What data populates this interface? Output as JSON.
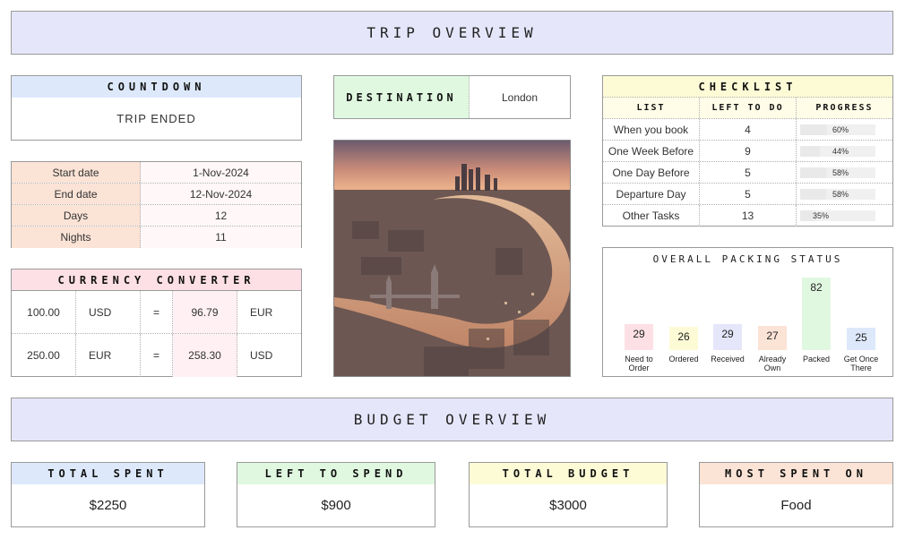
{
  "trip_overview": {
    "title": "TRIP OVERVIEW"
  },
  "countdown": {
    "title": "COUNTDOWN",
    "status": "TRIP ENDED"
  },
  "dates": {
    "rows": [
      {
        "label": "Start date",
        "value": "1-Nov-2024"
      },
      {
        "label": "End date",
        "value": "12-Nov-2024"
      },
      {
        "label": "Days",
        "value": "12"
      },
      {
        "label": "Nights",
        "value": "11"
      }
    ]
  },
  "currency": {
    "title": "CURRENCY CONVERTER",
    "rows": [
      {
        "amount": "100.00",
        "from": "USD",
        "eq": "=",
        "result": "96.79",
        "to": "EUR"
      },
      {
        "amount": "250.00",
        "from": "EUR",
        "eq": "=",
        "result": "258.30",
        "to": "USD"
      }
    ]
  },
  "destination": {
    "label": "DESTINATION",
    "value": "London"
  },
  "checklist": {
    "title": "CHECKLIST",
    "headers": [
      "LIST",
      "LEFT TO DO",
      "PROGRESS"
    ],
    "rows": [
      {
        "list": "When you book",
        "left": "4",
        "progress": "60%",
        "progress_value": 0.6
      },
      {
        "list": "One Week Before",
        "left": "9",
        "progress": "44%",
        "progress_value": 0.44
      },
      {
        "list": "One Day Before",
        "left": "5",
        "progress": "58%",
        "progress_value": 0.58
      },
      {
        "list": "Departure Day",
        "left": "5",
        "progress": "58%",
        "progress_value": 0.58
      },
      {
        "list": "Other Tasks",
        "left": "13",
        "progress": "35%",
        "progress_value": 0.35
      }
    ]
  },
  "chart_data": {
    "type": "bar",
    "title": "OVERALL PACKING STATUS",
    "categories": [
      "Need to Order",
      "Ordered",
      "Received",
      "Already Own",
      "Packed",
      "Get Once There"
    ],
    "category_lines": [
      [
        "Need to",
        "Order"
      ],
      [
        "Ordered"
      ],
      [
        "Received"
      ],
      [
        "Already",
        "Own"
      ],
      [
        "Packed"
      ],
      [
        "Get Once",
        "There"
      ]
    ],
    "values": [
      29,
      26,
      29,
      27,
      82,
      25
    ],
    "colors": [
      "#fde0e6",
      "#fdfbd6",
      "#e6e6fb",
      "#fbe3d6",
      "#e0f8e0",
      "#dde9fb"
    ],
    "ylim": [
      0,
      85
    ],
    "grid": false
  },
  "budget_overview": {
    "title": "BUDGET OVERVIEW"
  },
  "budget_cards": [
    {
      "title": "TOTAL SPENT",
      "value": "$2250",
      "color": "#dde9fb"
    },
    {
      "title": "LEFT TO SPEND",
      "value": "$900",
      "color": "#e0f8e0"
    },
    {
      "title": "TOTAL BUDGET",
      "value": "$3000",
      "color": "#fdfbd6"
    },
    {
      "title": "MOST SPENT ON",
      "value": "Food",
      "color": "#fbe3d6"
    }
  ],
  "colors": {
    "banner": "#e6e6fb",
    "countdown_header": "#dde9fb",
    "dates_label_bg": "#fbe3d6",
    "dates_value_bg": "#fff7f8",
    "currency_header": "#fde0e6",
    "currency_result_bg": "#fff0f3",
    "destination_label_bg": "#e0f8e0",
    "checklist_header": "#fdfbd6",
    "checklist_subheader": "#fffde8"
  },
  "image": {
    "name": "london-thames-photo"
  }
}
